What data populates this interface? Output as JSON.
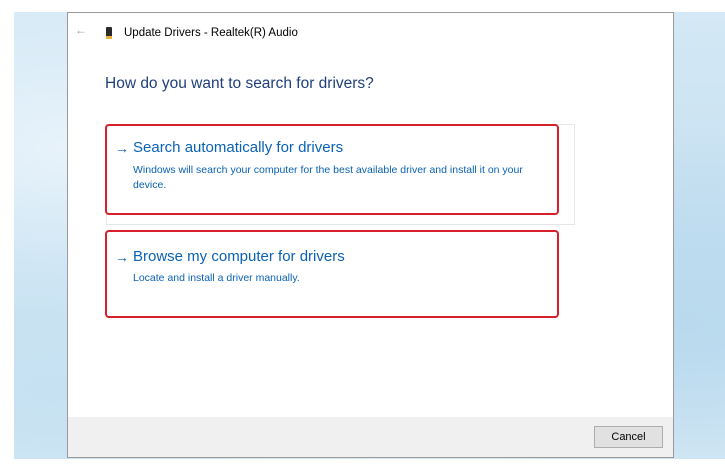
{
  "window": {
    "title": "Update Drivers - Realtek(R) Audio",
    "back_icon": "←"
  },
  "main": {
    "heading": "How do you want to search for drivers?",
    "options": [
      {
        "arrow": "→",
        "title": "Search automatically for drivers",
        "description": "Windows will search your computer for the best available driver and install it on your device."
      },
      {
        "arrow": "→",
        "title": "Browse my computer for drivers",
        "description": "Locate and install a driver manually."
      }
    ]
  },
  "footer": {
    "cancel_label": "Cancel"
  },
  "colors": {
    "link_blue": "#0a62b4",
    "heading_blue": "#1f3f7a",
    "highlight_red": "#d6202c",
    "footer_gray": "#f0f0f0"
  }
}
